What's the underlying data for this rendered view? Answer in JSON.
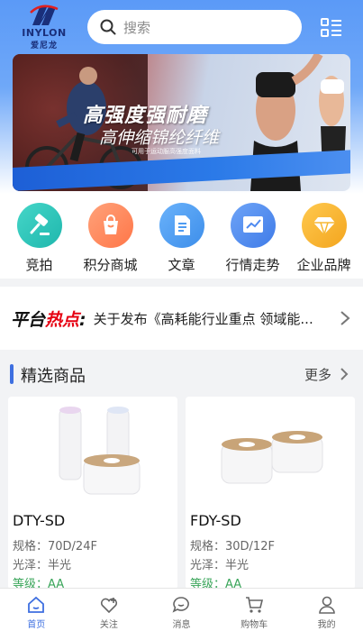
{
  "header": {
    "logo_brand": "INYLON",
    "logo_brand_cn": "爱尼龙",
    "search_placeholder": "搜索"
  },
  "banner": {
    "headline": "高强度强耐磨",
    "subline": "高伸缩锦纶纤维",
    "tiny_text": "可用于运动服高强度面料"
  },
  "quick_nav": [
    {
      "label": "竞拍",
      "icon": "gavel-icon",
      "color": "#27c5b8"
    },
    {
      "label": "积分商城",
      "icon": "shopping-bag-icon",
      "color": "#ff8a5b"
    },
    {
      "label": "文章",
      "icon": "document-icon",
      "color": "#4f9cf2"
    },
    {
      "label": "行情走势",
      "icon": "trend-chart-icon",
      "color": "#4f8af0"
    },
    {
      "label": "企业品牌",
      "icon": "diamond-icon",
      "color": "#f7b733"
    }
  ],
  "news": {
    "tag_part1": "平台",
    "tag_part2": "热点",
    "tag_colon": ":",
    "text": "关于发布《高耗能行业重点 领域能..."
  },
  "products_section": {
    "title": "精选商品",
    "more": "更多"
  },
  "products": [
    {
      "name": "DTY-SD",
      "spec": "规格：70D/24F",
      "gloss": "光泽：半光",
      "grade": "等级：AA"
    },
    {
      "name": "FDY-SD",
      "spec": "规格：30D/12F",
      "gloss": "光泽：半光",
      "grade": "等级：AA"
    }
  ],
  "tabbar": [
    {
      "label": "首页",
      "icon": "home-icon",
      "active": true
    },
    {
      "label": "关注",
      "icon": "heart-plus-icon",
      "active": false
    },
    {
      "label": "消息",
      "icon": "chat-bubble-icon",
      "active": false
    },
    {
      "label": "购物车",
      "icon": "cart-icon",
      "active": false
    },
    {
      "label": "我的",
      "icon": "user-icon",
      "active": false
    }
  ],
  "colors": {
    "accent": "#3e6fe0",
    "grade_green": "#3aa55a",
    "hot_red": "#e60012"
  }
}
